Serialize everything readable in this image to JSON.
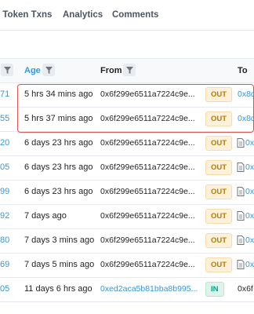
{
  "tabs": [
    {
      "label": "l Token Txns"
    },
    {
      "label": "Analytics"
    },
    {
      "label": "Comments"
    }
  ],
  "table": {
    "headers": {
      "age": "Age",
      "from": "From",
      "to": "To"
    },
    "rows": [
      {
        "block": "71",
        "age": "5 hrs 34 mins ago",
        "from": "0x6f299e6511a7224c9e...",
        "direction": "OUT",
        "to": "0x8d"
      },
      {
        "block": "55",
        "age": "5 hrs 37 mins ago",
        "from": "0x6f299e6511a7224c9e...",
        "direction": "OUT",
        "to": "0x8d"
      },
      {
        "block": "20",
        "age": "6 days 23 hrs ago",
        "from": "0x6f299e6511a7224c9e...",
        "direction": "OUT",
        "to": "0x"
      },
      {
        "block": "05",
        "age": "6 days 23 hrs ago",
        "from": "0x6f299e6511a7224c9e...",
        "direction": "OUT",
        "to": "0x"
      },
      {
        "block": "99",
        "age": "6 days 23 hrs ago",
        "from": "0x6f299e6511a7224c9e...",
        "direction": "OUT",
        "to": "0x"
      },
      {
        "block": "92",
        "age": "7 days ago",
        "from": "0x6f299e6511a7224c9e...",
        "direction": "OUT",
        "to": "0x"
      },
      {
        "block": "80",
        "age": "7 days 3 mins ago",
        "from": "0x6f299e6511a7224c9e...",
        "direction": "OUT",
        "to": "0x"
      },
      {
        "block": "69",
        "age": "7 days 5 mins ago",
        "from": "0x6f299e6511a7224c9e...",
        "direction": "OUT",
        "to": "0x"
      },
      {
        "block": "05",
        "age": "11 days 6 hrs ago",
        "from": "0xed2aca5b81bba8b995...",
        "direction": "IN",
        "to": "0x6f"
      }
    ]
  },
  "colors": {
    "link": "#3498db",
    "highlight": "#d9534f",
    "out_badge_bg": "#fdf1dc",
    "in_badge_bg": "#ddf4ea"
  }
}
